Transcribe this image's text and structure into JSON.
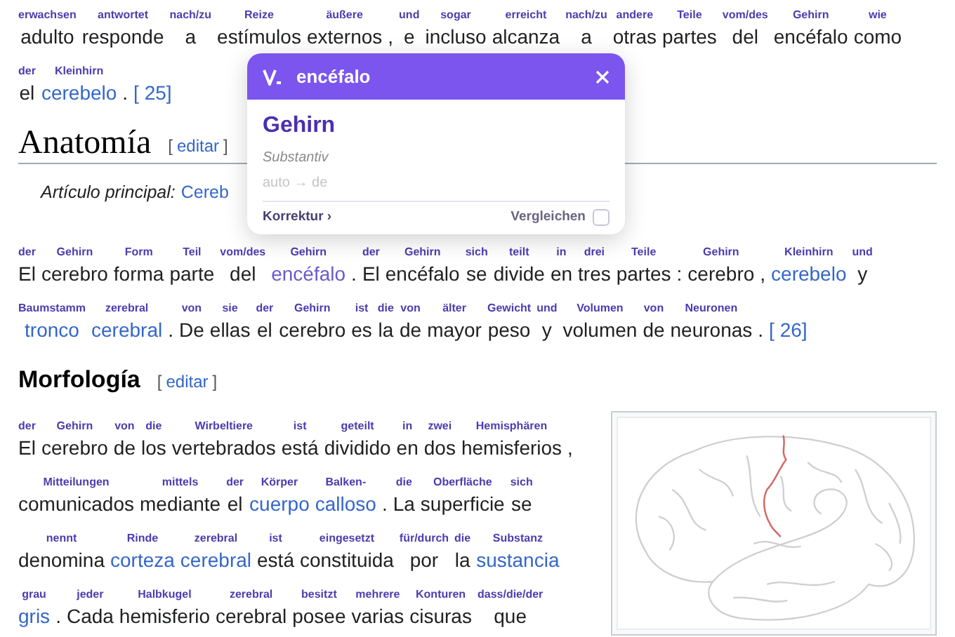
{
  "intro_lines": [
    [
      {
        "kind": "word",
        "text": "adulto",
        "gloss": "erwachsen"
      },
      {
        "kind": "word",
        "text": "responde",
        "gloss": "antwortet"
      },
      {
        "kind": "word",
        "text": "a",
        "gloss": "nach/zu"
      },
      {
        "kind": "word",
        "text": "estímulos",
        "gloss": "Reize"
      },
      {
        "kind": "word",
        "text": "externos",
        "gloss": "äußere"
      },
      {
        "kind": "punct",
        "text": ","
      },
      {
        "kind": "word",
        "text": "e",
        "gloss": "und"
      },
      {
        "kind": "word",
        "text": "incluso",
        "gloss": "sogar"
      },
      {
        "kind": "word",
        "text": "alcanza",
        "gloss": "erreicht"
      },
      {
        "kind": "word",
        "text": "a",
        "gloss": "nach/zu"
      },
      {
        "kind": "word",
        "text": "otras",
        "gloss": "andere"
      },
      {
        "kind": "word",
        "text": "partes",
        "gloss": "Teile"
      },
      {
        "kind": "word",
        "text": "del",
        "gloss": "vom/des"
      },
      {
        "kind": "word",
        "text": "encéfalo",
        "gloss": "Gehirn"
      },
      {
        "kind": "word",
        "text": "como",
        "gloss": "wie"
      }
    ],
    [
      {
        "kind": "word",
        "text": "el",
        "gloss": "der"
      },
      {
        "kind": "link",
        "text": "cerebelo",
        "gloss": "Kleinhirn"
      },
      {
        "kind": "punct",
        "text": "."
      },
      {
        "kind": "ref",
        "text": "[ 25]"
      }
    ]
  ],
  "sections": [
    {
      "kind": "h2",
      "heading": "Anatomía",
      "edit_open": "[",
      "edit_label": "editar",
      "edit_close": "]",
      "main_article": {
        "label": "Artículo principal:",
        "link": "Cereb"
      },
      "lines": [
        [
          {
            "kind": "word",
            "text": "El",
            "gloss": "der"
          },
          {
            "kind": "word",
            "text": "cerebro",
            "gloss": "Gehirn"
          },
          {
            "kind": "word",
            "text": "forma",
            "gloss": "Form"
          },
          {
            "kind": "word",
            "text": "parte",
            "gloss": "Teil"
          },
          {
            "kind": "word",
            "text": "del",
            "gloss": "vom/des"
          },
          {
            "kind": "selected",
            "text": "encéfalo",
            "gloss": "Gehirn"
          },
          {
            "kind": "punct",
            "text": "."
          },
          {
            "kind": "word",
            "text": "El",
            "gloss": "der"
          },
          {
            "kind": "word",
            "text": "encéfalo",
            "gloss": "Gehirn"
          },
          {
            "kind": "word",
            "text": "se",
            "gloss": "sich"
          },
          {
            "kind": "word",
            "text": "divide",
            "gloss": "teilt"
          },
          {
            "kind": "word",
            "text": "en",
            "gloss": "in"
          },
          {
            "kind": "word",
            "text": "tres",
            "gloss": "drei"
          },
          {
            "kind": "word",
            "text": "partes",
            "gloss": "Teile"
          },
          {
            "kind": "punct",
            "text": ":"
          },
          {
            "kind": "word",
            "text": "cerebro",
            "gloss": "Gehirn"
          },
          {
            "kind": "punct",
            "text": ","
          },
          {
            "kind": "link",
            "text": "cerebelo",
            "gloss": "Kleinhirn"
          },
          {
            "kind": "word",
            "text": "y",
            "gloss": "und"
          }
        ],
        [
          {
            "kind": "link",
            "text": "tronco",
            "gloss": "Baumstamm"
          },
          {
            "kind": "link",
            "text": "cerebral",
            "gloss": "zerebral"
          },
          {
            "kind": "punct",
            "text": "."
          },
          {
            "kind": "word",
            "text": "De",
            "gloss": "von"
          },
          {
            "kind": "word",
            "text": "ellas",
            "gloss": "sie"
          },
          {
            "kind": "word",
            "text": "el",
            "gloss": "der"
          },
          {
            "kind": "word",
            "text": "cerebro",
            "gloss": "Gehirn"
          },
          {
            "kind": "word",
            "text": "es",
            "gloss": "ist"
          },
          {
            "kind": "word",
            "text": "la",
            "gloss": "die"
          },
          {
            "kind": "word",
            "text": "de",
            "gloss": "von"
          },
          {
            "kind": "word",
            "text": "mayor",
            "gloss": "älter"
          },
          {
            "kind": "word",
            "text": "peso",
            "gloss": "Gewicht"
          },
          {
            "kind": "word",
            "text": "y",
            "gloss": "und"
          },
          {
            "kind": "word",
            "text": "volumen",
            "gloss": "Volumen"
          },
          {
            "kind": "word",
            "text": "de",
            "gloss": "von"
          },
          {
            "kind": "word",
            "text": "neuronas",
            "gloss": "Neuronen"
          },
          {
            "kind": "punct",
            "text": "."
          },
          {
            "kind": "ref",
            "text": "[ 26]"
          }
        ]
      ]
    },
    {
      "kind": "h3",
      "heading": "Morfología",
      "edit_open": "[",
      "edit_label": "editar",
      "edit_close": "]",
      "figure": true,
      "lines": [
        [
          {
            "kind": "word",
            "text": "El",
            "gloss": "der"
          },
          {
            "kind": "word",
            "text": "cerebro",
            "gloss": "Gehirn"
          },
          {
            "kind": "word",
            "text": "de",
            "gloss": "von"
          },
          {
            "kind": "word",
            "text": "los",
            "gloss": "die"
          },
          {
            "kind": "word",
            "text": "vertebrados",
            "gloss": "Wirbeltiere"
          },
          {
            "kind": "word",
            "text": "está",
            "gloss": "ist"
          },
          {
            "kind": "word",
            "text": "dividido",
            "gloss": "geteilt"
          },
          {
            "kind": "word",
            "text": "en",
            "gloss": "in"
          },
          {
            "kind": "word",
            "text": "dos",
            "gloss": "zwei"
          },
          {
            "kind": "word",
            "text": "hemisferios",
            "gloss": "Hemisphären"
          },
          {
            "kind": "punct",
            "text": ","
          }
        ],
        [
          {
            "kind": "word",
            "text": "comunicados",
            "gloss": "Mitteilungen"
          },
          {
            "kind": "word",
            "text": "mediante",
            "gloss": "mittels"
          },
          {
            "kind": "word",
            "text": "el",
            "gloss": "der"
          },
          {
            "kind": "link",
            "text": "cuerpo",
            "gloss": "Körper"
          },
          {
            "kind": "link",
            "text": "calloso",
            "gloss": "Balken-"
          },
          {
            "kind": "punct",
            "text": "."
          },
          {
            "kind": "word",
            "text": "La",
            "gloss": "die"
          },
          {
            "kind": "word",
            "text": "superficie",
            "gloss": "Oberfläche"
          },
          {
            "kind": "word",
            "text": "se",
            "gloss": "sich"
          }
        ],
        [
          {
            "kind": "word",
            "text": "denomina",
            "gloss": "nennt"
          },
          {
            "kind": "link",
            "text": "corteza",
            "gloss": "Rinde"
          },
          {
            "kind": "link",
            "text": "cerebral",
            "gloss": "zerebral"
          },
          {
            "kind": "word",
            "text": "está",
            "gloss": "ist"
          },
          {
            "kind": "word",
            "text": "constituida",
            "gloss": "eingesetzt"
          },
          {
            "kind": "word",
            "text": "por",
            "gloss": "für/durch"
          },
          {
            "kind": "word",
            "text": "la",
            "gloss": "die"
          },
          {
            "kind": "link",
            "text": "sustancia",
            "gloss": "Substanz"
          }
        ],
        [
          {
            "kind": "link",
            "text": "gris",
            "gloss": "grau"
          },
          {
            "kind": "punct",
            "text": "."
          },
          {
            "kind": "word",
            "text": "Cada",
            "gloss": "jeder"
          },
          {
            "kind": "word",
            "text": "hemisferio",
            "gloss": "Halbkugel"
          },
          {
            "kind": "word",
            "text": "cerebral",
            "gloss": "zerebral"
          },
          {
            "kind": "word",
            "text": "posee",
            "gloss": "besitzt"
          },
          {
            "kind": "word",
            "text": "varias",
            "gloss": "mehrere"
          },
          {
            "kind": "word",
            "text": "cisuras",
            "gloss": "Konturen"
          },
          {
            "kind": "word",
            "text": "que",
            "gloss": "dass/die/der"
          }
        ]
      ]
    }
  ],
  "popup": {
    "title": "encéfalo",
    "translation": "Gehirn",
    "part_of_speech": "Substantiv",
    "language": "auto → de",
    "correction": "Korrektur ›",
    "compare_label": "Vergleichen",
    "compare_checked": false
  }
}
